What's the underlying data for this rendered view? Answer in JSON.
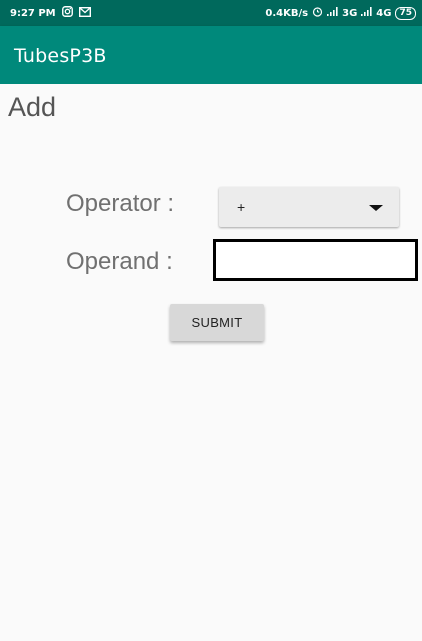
{
  "status_bar": {
    "time": "9:27 PM",
    "left_icons": [
      "instagram-icon",
      "mail-icon"
    ],
    "network_speed": "0.4KB/s",
    "signal_1": "3G",
    "signal_2": "4G",
    "battery": "75"
  },
  "app_bar": {
    "title": "TubesP3B",
    "color": "#00897b"
  },
  "page": {
    "title": "Add"
  },
  "form": {
    "operator_label": "Operator :",
    "operator_value": "+",
    "operand_label": "Operand :",
    "operand_value": "",
    "submit_label": "SUBMIT"
  }
}
